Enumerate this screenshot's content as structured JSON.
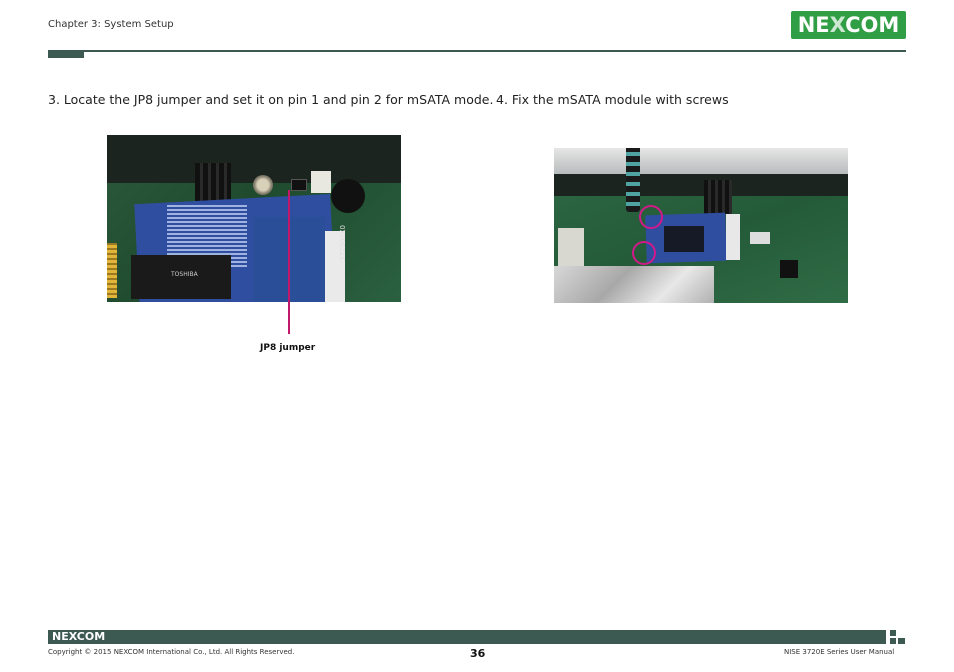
{
  "header": {
    "chapter": "Chapter 3: System Setup",
    "logo_text_a": "NE",
    "logo_text_x": "X",
    "logo_text_b": "COM",
    "accent_color": "#3c5a52",
    "logo_color": "#2f9e45"
  },
  "steps": {
    "step3": "3. Locate the JP8 jumper and set it on pin 1 and pin 2 for mSATA mode.",
    "step4": "4. Fix the mSATA module with screws"
  },
  "figure1": {
    "chip_text": "TOSHIBA",
    "board_label": "372000X0",
    "callout": "JP8 jumper",
    "callout_color": "#c2186b"
  },
  "figure2": {
    "highlight_color": "#d11a8a"
  },
  "footer": {
    "logo": "NEXCOM",
    "copyright": "Copyright © 2015 NEXCOM International Co., Ltd. All Rights Reserved.",
    "page": "36",
    "manual": "NISE 3720E Series User Manual"
  }
}
